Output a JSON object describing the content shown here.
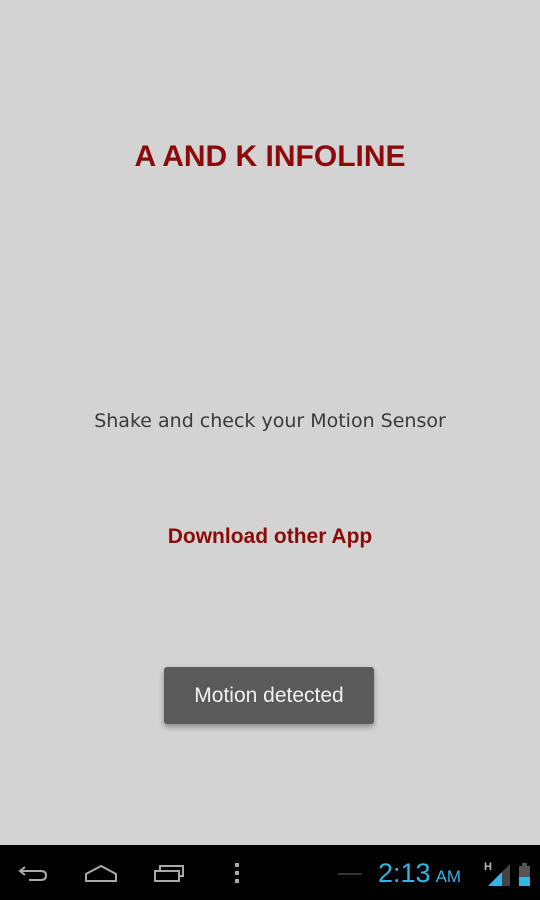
{
  "app": {
    "title": "A AND K INFOLINE",
    "instruction": "Shake and check your Motion Sensor",
    "download_link": "Download other App",
    "toast": "Motion detected",
    "colors": {
      "accent": "#8b0a0a",
      "background": "#d3d3d3",
      "toast_bg": "#5a5a5a"
    }
  },
  "system_bar": {
    "nav_buttons": [
      {
        "name": "back",
        "icon": "back-arrow-icon"
      },
      {
        "name": "home",
        "icon": "home-icon"
      },
      {
        "name": "recent-apps",
        "icon": "recent-apps-icon"
      },
      {
        "name": "menu",
        "icon": "overflow-menu-icon"
      }
    ],
    "time": "2:13",
    "ampm": "AM",
    "network_type": "H",
    "clock_color": "#33b5e5"
  }
}
